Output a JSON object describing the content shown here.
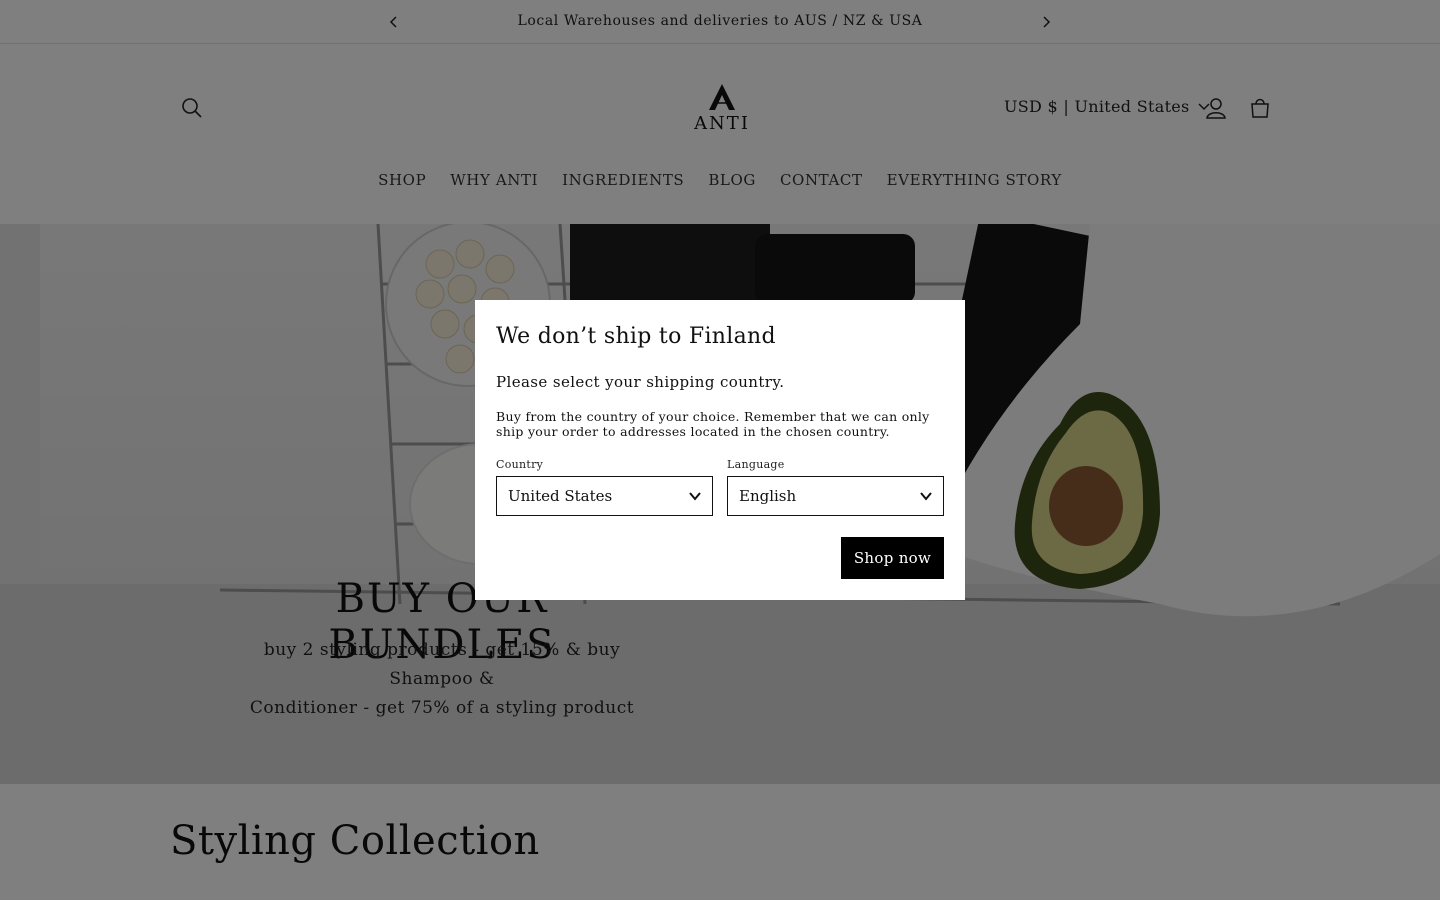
{
  "announcement": {
    "text": "Local Warehouses and deliveries to AUS / NZ & USA",
    "prev_icon": "chevron-left-icon",
    "next_icon": "chevron-right-icon"
  },
  "header": {
    "brand": "ANTI",
    "locale": "USD $ | United States",
    "icons": [
      "search-icon",
      "user-icon",
      "cart-icon",
      "chevron-down-icon"
    ]
  },
  "nav": {
    "items": [
      {
        "label": "SHOP"
      },
      {
        "label": "WHY ANTI"
      },
      {
        "label": "INGREDIENTS"
      },
      {
        "label": "BLOG"
      },
      {
        "label": "CONTACT"
      },
      {
        "label": "EVERYTHING STORY"
      }
    ]
  },
  "hero": {
    "title": "BUY OUR BUNDLES",
    "subtitle_line1": "buy 2 styling products - get 15% & buy Shampoo &",
    "subtitle_line2": "Conditioner - get 75% of a styling product"
  },
  "collection": {
    "title": "Styling Collection"
  },
  "modal": {
    "title": "We don’t ship to Finland",
    "lead": "Please select your shipping country.",
    "note": "Buy from the country of your choice. Remember that we can only ship your order to addresses located in the chosen country.",
    "country_label": "Country",
    "country_value": "United States",
    "language_label": "Language",
    "language_value": "English",
    "button": "Shop now"
  }
}
